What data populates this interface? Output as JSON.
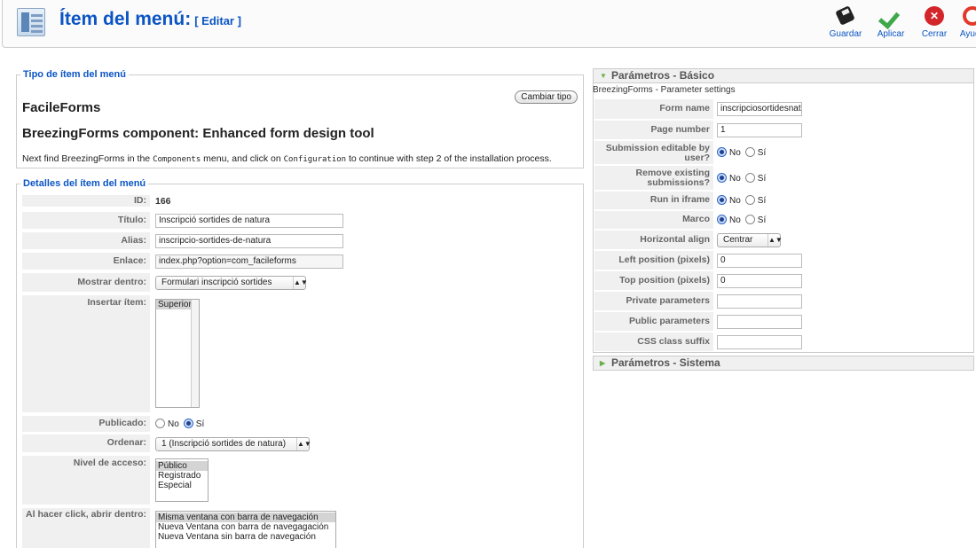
{
  "header": {
    "title": "Ítem del menú:",
    "subtitle": "[ Editar ]",
    "buttons": {
      "save": "Guardar",
      "apply": "Aplicar",
      "close": "Cerrar",
      "help": "Ayuda"
    }
  },
  "menu_type": {
    "legend": "Tipo de ítem del menú",
    "type_name": "FacileForms",
    "change_button": "Cambiar tipo",
    "component_title": "BreezingForms component: Enhanced form design tool",
    "note_pre": "Next find BreezingForms in the ",
    "note_code1": "Components",
    "note_mid": " menu, and click on ",
    "note_code2": "Configuration",
    "note_post": " to continue with step 2 of the installation process."
  },
  "details": {
    "legend": "Detalles del ítem del menú",
    "id_label": "ID:",
    "id_value": "166",
    "title_label": "Título:",
    "title_value": "Inscripció sortides de natura",
    "alias_label": "Alias:",
    "alias_value": "inscripcio-sortides-de-natura",
    "link_label": "Enlace:",
    "link_value": "index.php?option=com_facileforms",
    "show_in_label": "Mostrar dentro:",
    "show_in_value": "Formulari inscripció sortides",
    "insert_item_label": "Insertar ítem:",
    "insert_item_options": [
      "Superior"
    ],
    "published_label": "Publicado:",
    "published_no": "No",
    "published_yes": "Sí",
    "order_label": "Ordenar:",
    "order_value": "1 (Inscripció sortides de natura)",
    "access_label": "Nivel de acceso:",
    "access_options": [
      "Público",
      "Registrado",
      "Especial"
    ],
    "onclick_label": "Al hacer click, abrir dentro:",
    "onclick_options": [
      "Misma ventana con barra de navegación",
      "Nueva Ventana con barra de navegagación",
      "Nueva Ventana sin barra de navegación"
    ]
  },
  "params_basic": {
    "header": "Parámetros - Básico",
    "subtitle": "BreezingForms - Parameter settings",
    "form_name_label": "Form name",
    "form_name_value": "inscripciosortidesnat",
    "page_number_label": "Page number",
    "page_number_value": "1",
    "sub_editable_label": "Submission editable by user?",
    "remove_label": "Remove existing submissions?",
    "iframe_label": "Run in iframe",
    "marco_label": "Marco",
    "radio_no": "No",
    "radio_yes": "Sí",
    "halign_label": "Horizontal align",
    "halign_value": "Centrar",
    "left_label": "Left position (pixels)",
    "left_value": "0",
    "top_label": "Top position (pixels)",
    "top_value": "0",
    "private_label": "Private parameters",
    "public_label": "Public parameters",
    "css_label": "CSS class suffix"
  },
  "params_system": {
    "header": "Parámetros - Sistema"
  }
}
